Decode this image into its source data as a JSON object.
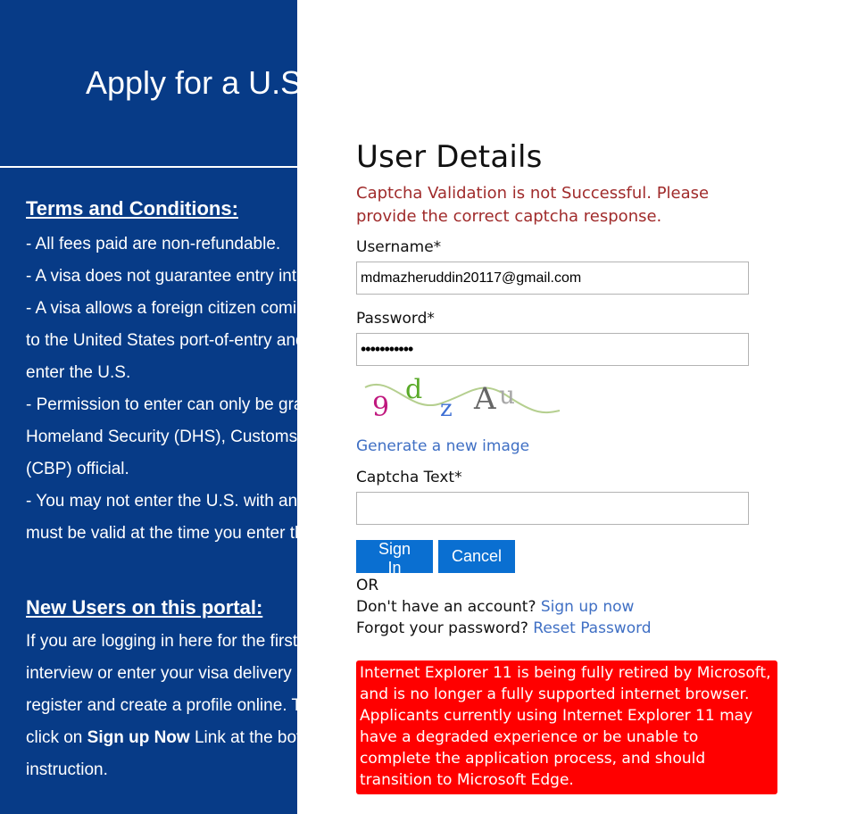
{
  "left": {
    "title": "Apply for a U.S. Visa",
    "terms_heading": "Terms and Conditions:",
    "terms_lines": [
      "- All fees paid are non-refundable.",
      "- A visa does not guarantee entry into the U.S.",
      "- A visa allows a foreign citizen coming from abroad, to travel",
      "to the United States port-of-entry and request permission to",
      "enter the U.S.",
      "- Permission to enter can only be granted by Department of",
      "Homeland Security (DHS), Customs and Border Protection",
      "(CBP) official.",
      "- You may not enter the U.S. with an expired visa. Your visa",
      "must be valid at the time you enter the U.S."
    ],
    "new_users_heading": "New Users on this portal:",
    "new_users_lines": [
      "If you are logging in here for the first time to schedule your",
      "interview or enter your visa delivery address, you must first",
      "register and create a profile online. To create a profile,",
      "instruction."
    ],
    "signup_line_prefix": "click on ",
    "signup_line_bold": "Sign up Now",
    "signup_line_suffix": " Link at the bottom and follow the"
  },
  "form": {
    "title": "User Details",
    "error": "Captcha Validation is not Successful. Please provide the correct captcha response.",
    "username_label": "Username*",
    "username_value": "mdmazheruddin20117@gmail.com",
    "password_label": "Password*",
    "password_value": "•••••••••••",
    "captcha_chars": [
      "9",
      "d",
      "z",
      "A",
      "u"
    ],
    "generate_link": "Generate a new image",
    "captcha_label": "Captcha Text*",
    "captcha_value": "",
    "signin_label": "Sign In",
    "cancel_label": "Cancel",
    "or_text": "OR",
    "no_account_text": "Don't have an account? ",
    "signup_link": "Sign up now",
    "forgot_text": "Forgot your password? ",
    "reset_link": "Reset Password",
    "ie_warning": "Internet Explorer 11 is being fully retired by Microsoft, and is no longer a fully supported internet browser. Applicants currently using Internet Explorer 11 may have a degraded experience or be unable to complete the application process, and should transition to Microsoft Edge."
  },
  "colors": {
    "left_panel_bg": "#073b87",
    "error_text": "#a02b2b",
    "button_bg": "#0a6fd1",
    "link": "#3f6fc4",
    "warning_bg": "#ff0000"
  }
}
